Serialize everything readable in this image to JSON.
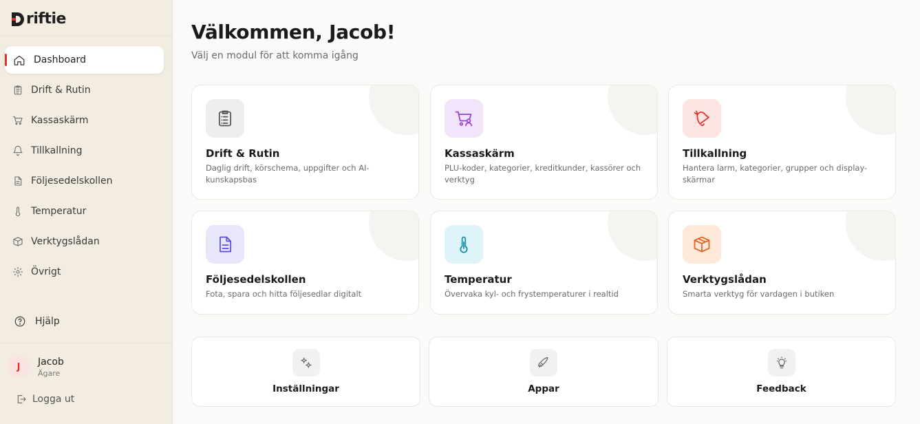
{
  "brand": {
    "name": "riftie",
    "accent": "#d9342b"
  },
  "sidebar": {
    "items": [
      {
        "label": "Dashboard",
        "icon": "home-icon",
        "active": true
      },
      {
        "label": "Drift & Rutin",
        "icon": "clipboard-icon"
      },
      {
        "label": "Kassaskärm",
        "icon": "cart-icon"
      },
      {
        "label": "Tillkallning",
        "icon": "bell-icon"
      },
      {
        "label": "Följesedelskollen",
        "icon": "document-icon"
      },
      {
        "label": "Temperatur",
        "icon": "thermometer-icon"
      },
      {
        "label": "Verktygslådan",
        "icon": "box-icon"
      },
      {
        "label": "Övrigt",
        "icon": "gear-icon"
      }
    ],
    "help": "Hjälp",
    "user": {
      "initial": "J",
      "name": "Jacob",
      "role": "Ägare"
    },
    "logout": "Logga ut"
  },
  "main": {
    "title": "Välkommen, Jacob!",
    "subtitle": "Välj en modul för att komma igång",
    "modules": [
      {
        "title": "Drift & Rutin",
        "description": "Daglig drift, körschema, uppgifter och AI-kunskapsbas",
        "icon": "clipboard-icon",
        "color": "#555555",
        "bg": "#eeeeee"
      },
      {
        "title": "Kassaskärm",
        "description": "PLU-koder, kategorier, kreditkunder, kassörer och verktyg",
        "icon": "cart-user-icon",
        "color": "#9b3fd6",
        "bg": "#f1e4fb"
      },
      {
        "title": "Tillkallning",
        "description": "Hantera larm, kategorier, grupper och display-skärmar",
        "icon": "bell-icon",
        "color": "#d9342b",
        "bg": "#fde4e3"
      },
      {
        "title": "Följesedelskollen",
        "description": "Fota, spara och hitta följesedlar digitalt",
        "icon": "document-icon",
        "color": "#5b4fd6",
        "bg": "#e8e6fb"
      },
      {
        "title": "Temperatur",
        "description": "Övervaka kyl- och frystemperaturer i realtid",
        "icon": "thermometer-icon",
        "color": "#148ea8",
        "bg": "#dff4f8"
      },
      {
        "title": "Verktygslådan",
        "description": "Smarta verktyg för vardagen i butiken",
        "icon": "box-icon",
        "color": "#e0621c",
        "bg": "#fde8da"
      }
    ],
    "shortcuts": [
      {
        "label": "Inställningar",
        "icon": "gears-icon"
      },
      {
        "label": "Appar",
        "icon": "rocket-icon"
      },
      {
        "label": "Feedback",
        "icon": "lightbulb-icon"
      }
    ]
  }
}
